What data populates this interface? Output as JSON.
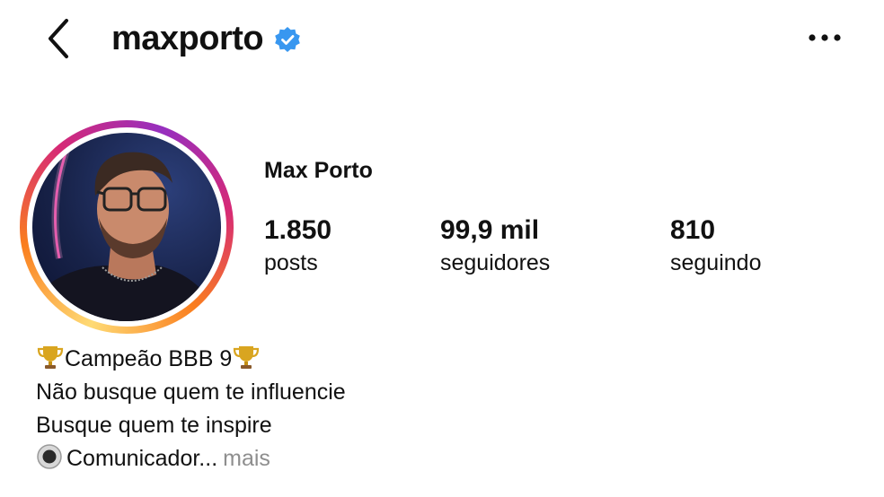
{
  "header": {
    "username": "maxporto",
    "back_icon": "chevron-left-icon",
    "verified_icon": "verified-badge-icon",
    "verified_color": "#3897f0",
    "more_icon": "more-horizontal-icon"
  },
  "profile": {
    "full_name": "Max Porto",
    "avatar_ring_colors": [
      "#feda75",
      "#fa7e1e",
      "#d62976",
      "#962fbf"
    ]
  },
  "stats": [
    {
      "value": "1.850",
      "label": "posts"
    },
    {
      "value": "99,9 mil",
      "label": "seguidores"
    },
    {
      "value": "810",
      "label": "seguindo"
    }
  ],
  "bio": {
    "line1": "Campeão BBB 9",
    "line1_icon": "trophy-icon",
    "line2": "Não busque quem te influencie",
    "line3": "Busque quem te inspire",
    "line4": "Comunicador...",
    "line4_icon": "radio-circle-icon",
    "more_label": "mais"
  }
}
